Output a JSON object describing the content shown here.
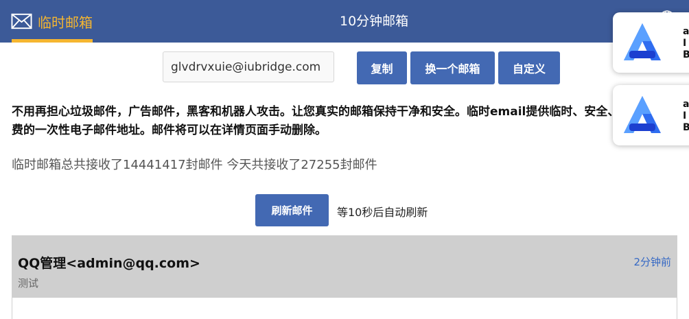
{
  "header": {
    "brand_label": "临时邮箱",
    "page_title": "10分钟邮箱",
    "accent_color": "#f5b630",
    "bar_color": "#3c5a98"
  },
  "mailbox": {
    "address": "glvdrvxuie@iubridge.com",
    "copy_label": "复制",
    "change_label": "换一个邮箱",
    "custom_label": "自定义"
  },
  "intro_text": "不用再担心垃圾邮件，广告邮件，黑客和机器人攻击。让您真实的邮箱保持干净和安全。临时email提供临时、安全、匿名、免费的一次性电子邮件地址。邮件将可以在详情页面手动删除。",
  "stats_text": "临时邮箱总共接收了14441417封邮件 今天共接收了27255封邮件",
  "refresh": {
    "button_label": "刷新邮件",
    "note": "等10秒后自动刷新"
  },
  "emails": [
    {
      "from": "QQ管理<admin@qq.com>",
      "subject": "测试",
      "time": "2分钟前"
    }
  ],
  "ads": [
    {
      "text_line1": "a",
      "text_line2": "I",
      "text_line3": "B"
    },
    {
      "text_line1": "a",
      "text_line2": "I",
      "text_line3": "B"
    }
  ]
}
